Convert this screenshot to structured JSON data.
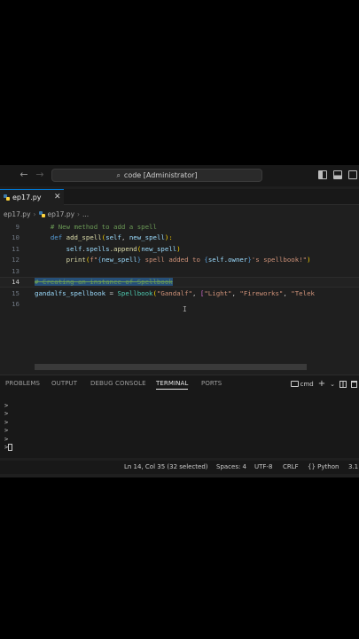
{
  "titlebar": {
    "back_icon": "arrow-left-icon",
    "forward_icon": "arrow-right-icon",
    "command_center": "code [Administrator]"
  },
  "tab": {
    "filename": "ep17.py",
    "close_glyph": "✕"
  },
  "breadcrumb": {
    "file": "ep17.py",
    "symbol": "..."
  },
  "editor": {
    "line_numbers": [
      "9",
      "10",
      "11",
      "12",
      "13",
      "14",
      "15",
      "16"
    ],
    "current_line": "14",
    "lines": {
      "l9_indent": "    ",
      "l9_comment": "# New method to add a spell",
      "l10_indent": "    ",
      "l10_def": "def",
      "l10_name": "add_spell",
      "l10_open": "(",
      "l10_self": "self",
      "l10_sep": ", ",
      "l10_param": "new_spell",
      "l10_close": "):",
      "l11_indent": "        ",
      "l11_self": "self",
      "l11_dot": ".",
      "l11_attr": "spells",
      "l11_append": ".append",
      "l11_open": "(",
      "l11_arg": "new_spell",
      "l11_close": ")",
      "l12_indent": "        ",
      "l12_print": "print",
      "l12_open": "(",
      "l12_f": "f\"",
      "l12_b1": "{",
      "l12_v1": "new_spell",
      "l12_b1c": "}",
      "l12_mid": " spell added to ",
      "l12_b2": "{",
      "l12_v2": "self.owner",
      "l12_b2c": "}",
      "l12_end": "'s spellbook!\"",
      "l12_close": ")",
      "l14_comment": "# Creating an instance of Spellbook",
      "l15_var": "gandalfs_spellbook",
      "l15_eq": " = ",
      "l15_cls": "Spellbook",
      "l15_open": "(",
      "l15_s1": "\"Gandalf\"",
      "l15_sep": ", ",
      "l15_list": "[",
      "l15_s2": "\"Light\"",
      "l15_sep2": ", ",
      "l15_s3": "\"Fireworks\"",
      "l15_sep3": ", ",
      "l15_s4": "\"Telek"
    }
  },
  "panel": {
    "tabs": [
      "PROBLEMS",
      "OUTPUT",
      "DEBUG CONSOLE",
      "TERMINAL",
      "PORTS"
    ],
    "active_tab": "TERMINAL",
    "shell": "cmd",
    "add_glyph": "+",
    "dropdown_glyph": "⌄",
    "terminal_lines": [
      ">",
      ">",
      ">",
      ">",
      ">",
      ">"
    ]
  },
  "status": {
    "position": "Ln 14, Col 35 (32 selected)",
    "spaces": "Spaces: 4",
    "encoding": "UTF-8",
    "eol": "CRLF",
    "language": "Python",
    "version": "3.1"
  },
  "colors": {
    "background": "#000000",
    "editor_bg": "#1f1f1f",
    "chrome_bg": "#181818",
    "accent": "#0078d4",
    "selection": "#264f78"
  }
}
